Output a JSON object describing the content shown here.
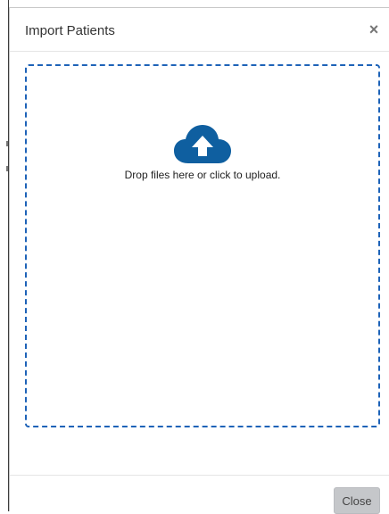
{
  "modal": {
    "title": "Import Patients",
    "close_icon": "close-icon",
    "close_glyph": "×"
  },
  "dropzone": {
    "icon": "cloud-upload-icon",
    "message": "Drop files here or click to upload."
  },
  "footer": {
    "close_label": "Close"
  },
  "colors": {
    "accent": "#1e63b8",
    "icon": "#0f5fa0",
    "button_bg": "#c5c7ca"
  }
}
